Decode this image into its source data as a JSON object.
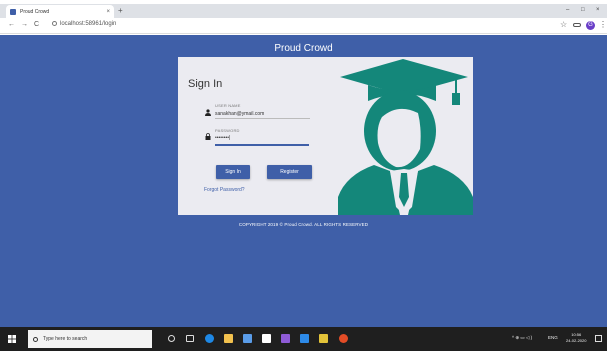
{
  "browser": {
    "tab_title": "Proud Crowd",
    "tab_close": "×",
    "new_tab": "+",
    "url": "localhost:58961/login",
    "back": "←",
    "forward": "→",
    "reload": "C",
    "bookmark_star": "☆",
    "profile_initial": "G",
    "menu": "⋮",
    "minimize": "–",
    "maximize": "□",
    "close": "×"
  },
  "page": {
    "brand": "Proud Crowd",
    "background_color": "#3f5fa8"
  },
  "login": {
    "heading": "Sign In",
    "username_label": "USER NAME",
    "username_value": "sanakhan@ymail.com",
    "password_label": "PASSWORD",
    "password_value": "••••••••|",
    "signin_button": "Sign In",
    "register_button": "Register",
    "forgot_link": "Forgot Password?"
  },
  "footer": {
    "copyright": "COPYRIGHT 2019 © Proud Crowd. ALL RIGHTS RESERVED"
  },
  "taskbar": {
    "search_placeholder": "Type here to search",
    "language": "ENG",
    "time": "10:56",
    "date": "24-02-2020",
    "apps": [
      "task-view",
      "edge",
      "file-explorer",
      "store",
      "mail",
      "visual-studio",
      "vscode",
      "sticky-notes",
      "chrome"
    ]
  },
  "icons": {
    "user": "user-icon",
    "lock": "lock-icon",
    "graduate": "graduate-illustration",
    "windows": "windows-start-icon"
  },
  "colors": {
    "accent": "#3f5fa8",
    "graduate_teal": "#14877a",
    "card_bg": "#ebebf1"
  }
}
